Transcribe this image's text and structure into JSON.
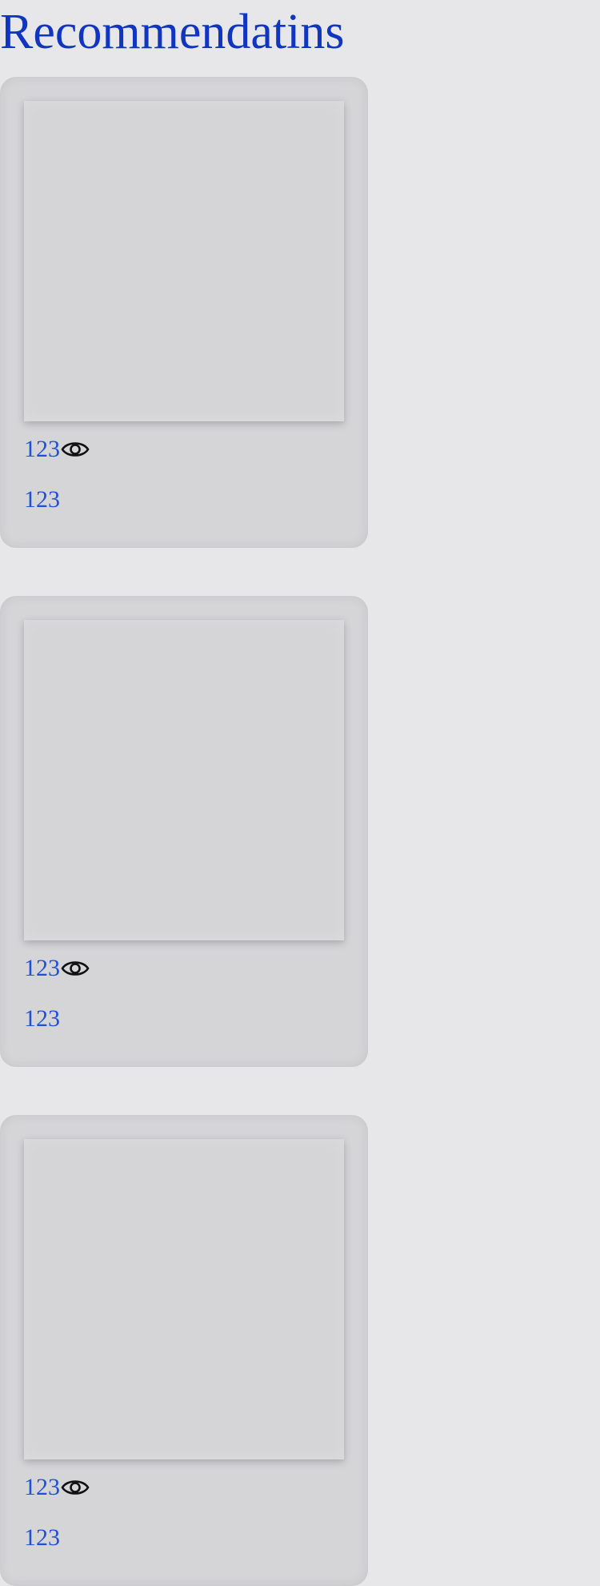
{
  "page": {
    "title": "Recommendatins"
  },
  "recommendations": [
    {
      "views": "123",
      "icon": "eye-icon",
      "secondary": "123"
    },
    {
      "views": "123",
      "icon": "eye-icon",
      "secondary": "123"
    },
    {
      "views": "123",
      "icon": "eye-icon",
      "secondary": "123"
    }
  ],
  "colors": {
    "background": "#e7e7ea",
    "card": "#d5d5d8",
    "title": "#1035c0",
    "text": "#1e50d8",
    "icon": "#111111"
  }
}
